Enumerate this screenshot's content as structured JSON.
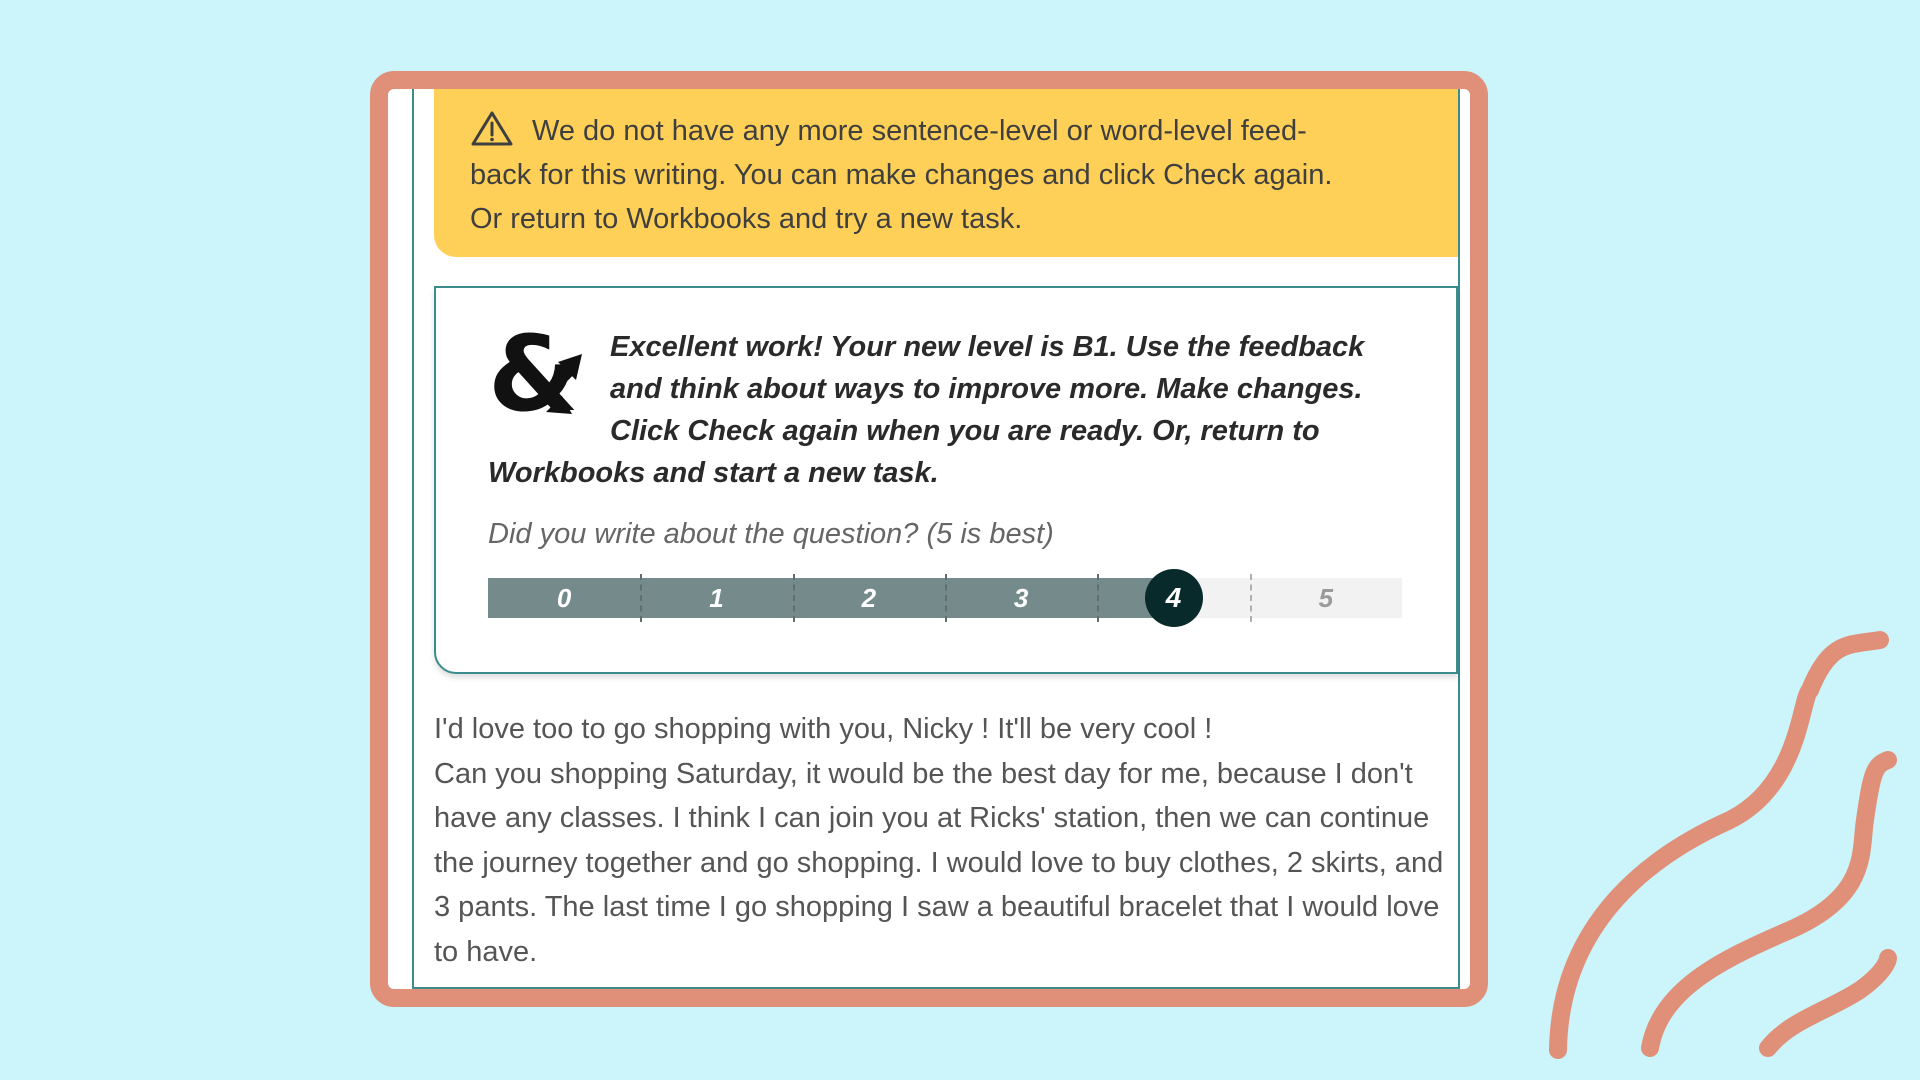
{
  "colors": {
    "background": "#cbf4fb",
    "frame": "#e09078",
    "warning_bg": "#ffd057",
    "accent_teal": "#3c8c8c",
    "scale_fill": "#758a8a",
    "scale_knob": "#082a2a"
  },
  "warning": {
    "icon": "warning-triangle-icon",
    "lines": [
      "We do not have any more sentence-level or word-level feed-",
      "back for this writing. You can make changes and click Check again.",
      "Or return to Workbooks and try a new task."
    ]
  },
  "feedback": {
    "logo_icon": "ampersand-logo-icon",
    "message": "Excellent work! Your new level is B1. Use the feedback and think about ways to improve more. Make changes. Click Check again when you are ready. Or, return to Workbooks and start a new task.",
    "question": "Did you write about the question? (5 is best)",
    "rating": {
      "options": [
        "0",
        "1",
        "2",
        "3",
        "4",
        "5"
      ],
      "selected": "4",
      "selected_index": 4
    }
  },
  "essay": {
    "lines": [
      "I'd love too to go shopping with you, Nicky ! It'll be very cool !",
      "Can you shopping Saturday, it would be the best day for me, because I don't have any classes. I think I can join you at Ricks' station, then we can continue the journey together and go shopping. I would love to buy clothes, 2 skirts, and 3 pants. The last time I go shopping I saw a beautiful bracelet that I would love to have."
    ]
  }
}
